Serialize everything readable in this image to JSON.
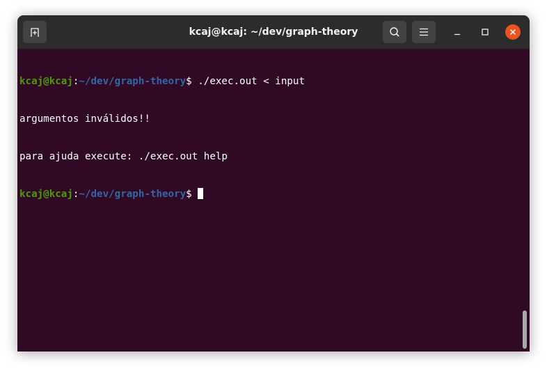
{
  "window": {
    "title": "kcaj@kcaj: ~/dev/graph-theory",
    "icons": {
      "new_tab": "new-tab-icon",
      "search": "search-icon",
      "menu": "hamburger-menu-icon",
      "minimize": "minimize-icon",
      "maximize": "maximize-icon",
      "close": "close-icon"
    },
    "colors": {
      "titlebar": "#2c2c2c",
      "terminal_bg": "#300a24",
      "prompt_user": "#4e9a06",
      "prompt_path": "#3465a4",
      "close_button": "#e95420"
    }
  },
  "terminal": {
    "lines": [
      {
        "user": "kcaj@kcaj",
        "sep": ":",
        "path": "~/dev/graph-theory",
        "symbol": "$ ",
        "command": "./exec.out < input"
      },
      {
        "text": "argumentos inválidos!!"
      },
      {
        "text": "para ajuda execute: ./exec.out help"
      },
      {
        "user": "kcaj@kcaj",
        "sep": ":",
        "path": "~/dev/graph-theory",
        "symbol": "$ ",
        "command": ""
      }
    ]
  }
}
